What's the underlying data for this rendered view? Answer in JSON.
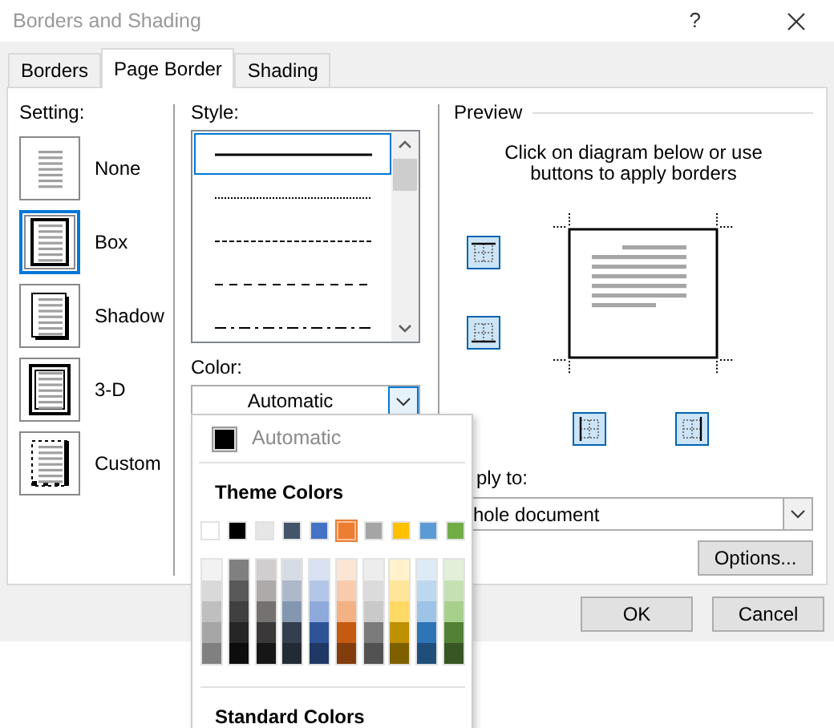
{
  "window": {
    "title": "Borders and Shading",
    "help": "?"
  },
  "tabs": [
    {
      "label": "Borders",
      "selected": false
    },
    {
      "label": "Page Border",
      "selected": true
    },
    {
      "label": "Shading",
      "selected": false
    }
  ],
  "setting": {
    "label": "Setting:",
    "items": [
      {
        "kind": "none",
        "label": "None",
        "selected": false
      },
      {
        "kind": "box",
        "label": "Box",
        "selected": true
      },
      {
        "kind": "shadow",
        "label": "Shadow",
        "selected": false
      },
      {
        "kind": "threed",
        "label": "3-D",
        "selected": false
      },
      {
        "kind": "custom",
        "label": "Custom",
        "selected": false
      }
    ]
  },
  "style": {
    "label": "Style:",
    "items": [
      {
        "kind": "solid",
        "selected": true
      },
      {
        "kind": "dotted",
        "selected": false
      },
      {
        "kind": "dashed",
        "selected": false
      },
      {
        "kind": "longdash",
        "selected": false
      },
      {
        "kind": "dashdot",
        "selected": false
      }
    ]
  },
  "color": {
    "label": "Color:",
    "value": "Automatic"
  },
  "color_popup": {
    "automatic": {
      "label": "Automatic",
      "color": "#000000"
    },
    "theme_header": "Theme Colors",
    "theme_colors": [
      {
        "color": "#ffffff",
        "selected": false
      },
      {
        "color": "#000000",
        "selected": false
      },
      {
        "color": "#e7e6e6",
        "selected": false
      },
      {
        "color": "#44546a",
        "selected": false
      },
      {
        "color": "#4472c4",
        "selected": false
      },
      {
        "color": "#ed7d31",
        "selected": true
      },
      {
        "color": "#a5a5a5",
        "selected": false
      },
      {
        "color": "#ffc000",
        "selected": false
      },
      {
        "color": "#5b9bd5",
        "selected": false
      },
      {
        "color": "#70ad47",
        "selected": false
      }
    ],
    "shade_columns": [
      {
        "swatches": [
          {
            "color": "#f2f2f2"
          },
          {
            "color": "#d9d9d9"
          },
          {
            "color": "#bfbfbf"
          },
          {
            "color": "#a6a6a6"
          },
          {
            "color": "#808080"
          }
        ]
      },
      {
        "swatches": [
          {
            "color": "#808080"
          },
          {
            "color": "#595959"
          },
          {
            "color": "#404040"
          },
          {
            "color": "#262626"
          },
          {
            "color": "#0d0d0d"
          }
        ]
      },
      {
        "swatches": [
          {
            "color": "#d0cece"
          },
          {
            "color": "#aeaaaa"
          },
          {
            "color": "#757171"
          },
          {
            "color": "#3a3838"
          },
          {
            "color": "#171616"
          }
        ]
      },
      {
        "swatches": [
          {
            "color": "#d6dce4"
          },
          {
            "color": "#adb9ca"
          },
          {
            "color": "#8497b0"
          },
          {
            "color": "#333f4f"
          },
          {
            "color": "#222a35"
          }
        ]
      },
      {
        "swatches": [
          {
            "color": "#d9e2f3"
          },
          {
            "color": "#b4c6e7"
          },
          {
            "color": "#8eaadb"
          },
          {
            "color": "#2f5496"
          },
          {
            "color": "#1f3864"
          }
        ]
      },
      {
        "swatches": [
          {
            "color": "#fbe5d5"
          },
          {
            "color": "#f7cbac"
          },
          {
            "color": "#f4b183"
          },
          {
            "color": "#c55a11"
          },
          {
            "color": "#833c0b"
          }
        ]
      },
      {
        "swatches": [
          {
            "color": "#ededed"
          },
          {
            "color": "#dbdbdb"
          },
          {
            "color": "#c9c9c9"
          },
          {
            "color": "#7b7b7b"
          },
          {
            "color": "#525252"
          }
        ]
      },
      {
        "swatches": [
          {
            "color": "#fff2cc"
          },
          {
            "color": "#fee599"
          },
          {
            "color": "#ffd966"
          },
          {
            "color": "#bf9000"
          },
          {
            "color": "#7f6000"
          }
        ]
      },
      {
        "swatches": [
          {
            "color": "#deebf6"
          },
          {
            "color": "#bdd7ee"
          },
          {
            "color": "#9dc3e6"
          },
          {
            "color": "#2e75b5"
          },
          {
            "color": "#1e4e79"
          }
        ]
      },
      {
        "swatches": [
          {
            "color": "#e2efd9"
          },
          {
            "color": "#c5e0b3"
          },
          {
            "color": "#a8d08d"
          },
          {
            "color": "#538135"
          },
          {
            "color": "#375623"
          }
        ]
      }
    ],
    "standard_header": "Standard Colors"
  },
  "preview": {
    "title": "Preview",
    "hint": "Click on diagram below or use buttons to apply borders",
    "border_buttons": [
      {
        "kind": "top",
        "on": true
      },
      {
        "kind": "bottom",
        "on": true
      },
      {
        "kind": "left",
        "on": true
      },
      {
        "kind": "right",
        "on": true
      }
    ]
  },
  "apply_to": {
    "label": "ply to:",
    "value": "hole document"
  },
  "options_button": "Options...",
  "buttons": [
    "OK",
    "Cancel"
  ]
}
